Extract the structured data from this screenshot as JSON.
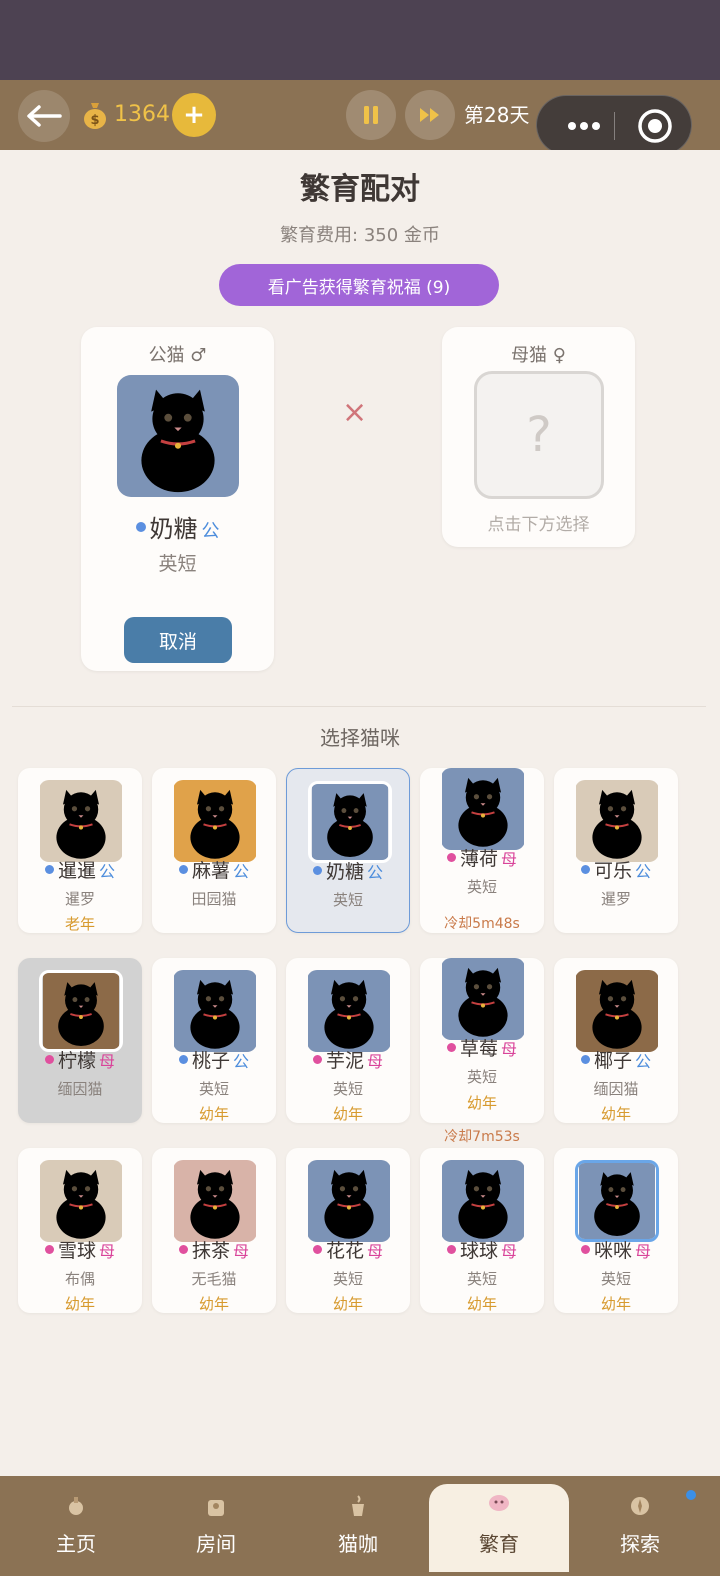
{
  "header": {
    "coins": "1364",
    "plus": "+",
    "day": "第28天"
  },
  "page": {
    "title": "繁育配对",
    "fee": "繁育费用: 350 金币",
    "ad_button": "看广告获得繁育祝福 (9)"
  },
  "male_slot": {
    "title": "公猫 ♂",
    "name": "奶糖",
    "gender": "公",
    "breed": "英短",
    "cancel": "取消"
  },
  "female_slot": {
    "title": "母猫 ♀",
    "placeholder": "?",
    "hint": "点击下方选择"
  },
  "cross": "×",
  "section_title": "选择猫咪",
  "cats": [
    {
      "name": "暹暹",
      "gender": "公",
      "breed": "暹罗",
      "age": "老年",
      "cooldown": ""
    },
    {
      "name": "麻薯",
      "gender": "公",
      "breed": "田园猫",
      "age": "",
      "cooldown": ""
    },
    {
      "name": "奶糖",
      "gender": "公",
      "breed": "英短",
      "age": "",
      "cooldown": ""
    },
    {
      "name": "薄荷",
      "gender": "母",
      "breed": "英短",
      "age": "",
      "cooldown": "冷却5m48s"
    },
    {
      "name": "可乐",
      "gender": "公",
      "breed": "暹罗",
      "age": "",
      "cooldown": ""
    },
    {
      "name": "柠檬",
      "gender": "母",
      "breed": "缅因猫",
      "age": "",
      "cooldown": ""
    },
    {
      "name": "桃子",
      "gender": "公",
      "breed": "英短",
      "age": "幼年",
      "cooldown": ""
    },
    {
      "name": "芋泥",
      "gender": "母",
      "breed": "英短",
      "age": "幼年",
      "cooldown": ""
    },
    {
      "name": "草莓",
      "gender": "母",
      "breed": "英短",
      "age": "幼年",
      "cooldown": "冷却7m53s"
    },
    {
      "name": "椰子",
      "gender": "公",
      "breed": "缅因猫",
      "age": "幼年",
      "cooldown": ""
    },
    {
      "name": "雪球",
      "gender": "母",
      "breed": "布偶",
      "age": "幼年",
      "cooldown": ""
    },
    {
      "name": "抹茶",
      "gender": "母",
      "breed": "无毛猫",
      "age": "幼年",
      "cooldown": ""
    },
    {
      "name": "花花",
      "gender": "母",
      "breed": "英短",
      "age": "幼年",
      "cooldown": ""
    },
    {
      "name": "球球",
      "gender": "母",
      "breed": "英短",
      "age": "幼年",
      "cooldown": ""
    },
    {
      "name": "咪咪",
      "gender": "母",
      "breed": "英短",
      "age": "幼年",
      "cooldown": ""
    }
  ],
  "tabs": [
    {
      "label": "主页",
      "icon": "home-icon"
    },
    {
      "label": "房间",
      "icon": "room-icon"
    },
    {
      "label": "猫咖",
      "icon": "cafe-icon"
    },
    {
      "label": "繁育",
      "icon": "breed-icon"
    },
    {
      "label": "探索",
      "icon": "explore-icon"
    }
  ],
  "colors": {
    "male_dot": "#5b8fe0",
    "female_dot": "#e0509e",
    "male_text": "#4d8ddc",
    "female_text": "#d9449a",
    "accent_purple": "#a165d8",
    "bar_brown": "#8b7254"
  }
}
